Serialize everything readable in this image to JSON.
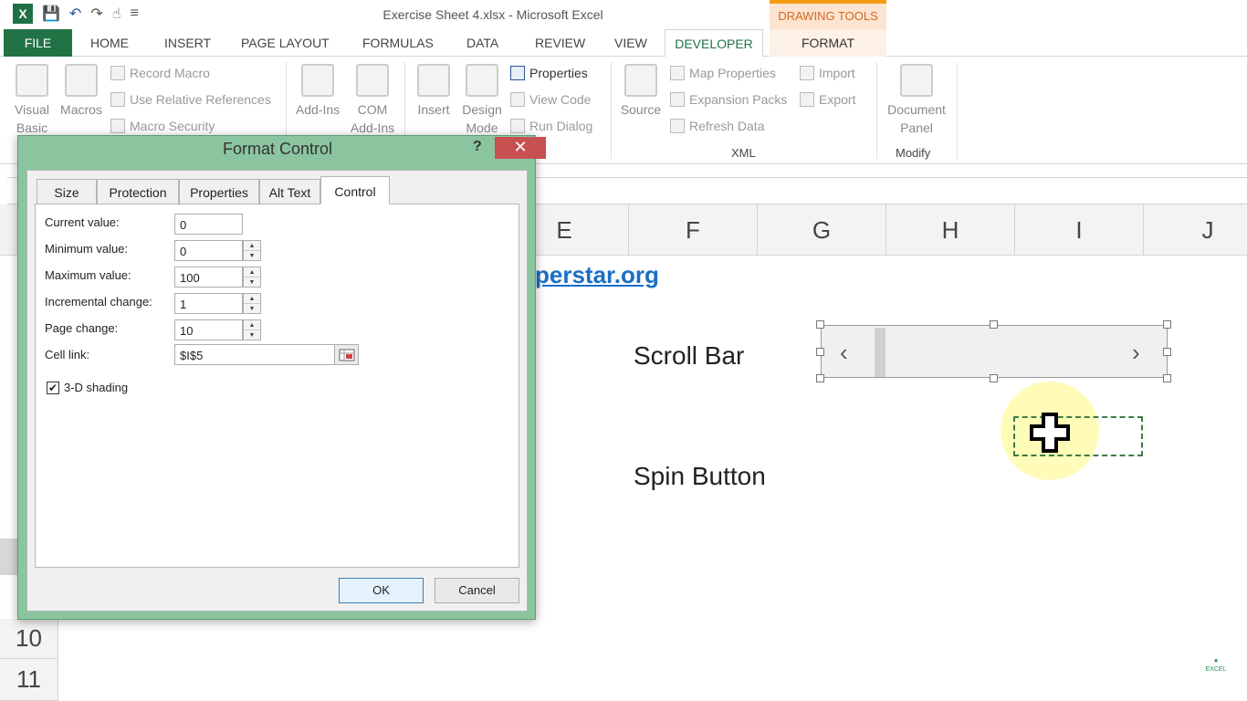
{
  "titlebar": {
    "app_title": "Exercise Sheet 4.xlsx - Microsoft Excel",
    "contextual_group": "DRAWING TOOLS",
    "logo_text": "X"
  },
  "tabs": {
    "file": "FILE",
    "home": "HOME",
    "insert": "INSERT",
    "page_layout": "PAGE LAYOUT",
    "formulas": "FORMULAS",
    "data": "DATA",
    "review": "REVIEW",
    "view": "VIEW",
    "developer": "DEVELOPER",
    "format": "FORMAT"
  },
  "ribbon": {
    "visual_basic": "Visual Basic",
    "macros": "Macros",
    "record_macro": "Record Macro",
    "use_relative_references": "Use Relative References",
    "macro_security": "Macro Security",
    "add_ins": "Add-Ins",
    "com_add_ins": "COM Add-Ins",
    "insert": "Insert",
    "design_mode": "Design Mode",
    "properties": "Properties",
    "view_code": "View Code",
    "run_dialog": "Run Dialog",
    "source": "Source",
    "map_properties": "Map Properties",
    "expansion_packs": "Expansion Packs",
    "refresh_data": "Refresh Data",
    "import": "Import",
    "export": "Export",
    "xml_group": "XML",
    "document_panel_line1": "Document",
    "document_panel_line2": "Panel",
    "modify_group": "Modify"
  },
  "columns": [
    "E",
    "F",
    "G",
    "H",
    "I",
    "J"
  ],
  "rows": [
    "10",
    "11"
  ],
  "sheet": {
    "link_text": "perstar.org",
    "scroll_bar_label": "Scroll Bar",
    "spin_button_label": "Spin Button",
    "scroll_left": "‹",
    "scroll_right": "›",
    "corner_logo": "EXCEL"
  },
  "dialog": {
    "title": "Format Control",
    "help": "?",
    "close": "✕",
    "tabs": [
      "Size",
      "Protection",
      "Properties",
      "Alt Text",
      "Control"
    ],
    "active_tab": "Control",
    "fields": {
      "current_value_label": "Current value:",
      "current_value": "0",
      "minimum_value_label": "Minimum value:",
      "minimum_value": "0",
      "maximum_value_label": "Maximum value:",
      "maximum_value": "100",
      "incremental_change_label": "Incremental change:",
      "incremental_change": "1",
      "page_change_label": "Page change:",
      "page_change": "10",
      "cell_link_label": "Cell link:",
      "cell_link": "$I$5"
    },
    "shading_label": "3-D shading",
    "shading_checked": "✔",
    "ok": "OK",
    "cancel": "Cancel"
  }
}
